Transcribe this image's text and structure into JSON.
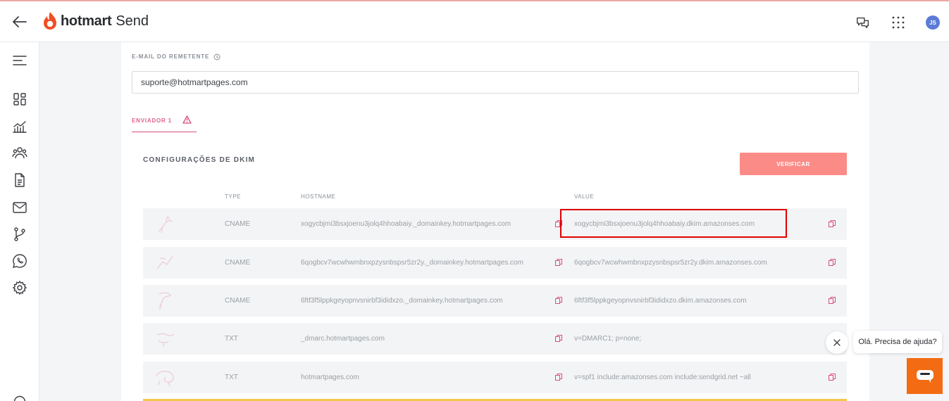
{
  "header": {
    "brand": "hotmart",
    "product": "Send",
    "avatar_initials": "JS"
  },
  "form": {
    "sender_email_label": "E-MAIL DO REMETENTE",
    "sender_email_value": "suporte@hotmartpages.com"
  },
  "tabs": [
    {
      "label": "ENVIADOR 1"
    }
  ],
  "dkim": {
    "title": "CONFIGURAÇÕES DE DKIM",
    "verify_label": "VERIFICAR",
    "columns": {
      "type": "TYPE",
      "hostname": "HOSTNAME",
      "value": "VALUE"
    },
    "rows": [
      {
        "type": "CNAME",
        "hostname": "xogycbjmi3bsxjoenu3jolq4hhoabaiy._domainkey.hotmartpages.com",
        "value": "xogycbjmi3bsxjoenu3jolq4hhoabaiy.dkim.amazonses.com"
      },
      {
        "type": "CNAME",
        "hostname": "6qogbcv7wcwhwmbnxpzysnbspsr5zr2y._domainkey.hotmartpages.com",
        "value": "6qogbcv7wcwhwmbnxpzysnbspsr5zr2y.dkim.amazonses.com"
      },
      {
        "type": "CNAME",
        "hostname": "6ftf3f5lppkgeyopnvsnirbf3ididxzo._domainkey.hotmartpages.com",
        "value": "6ftf3f5lppkgeyopnvsnirbf3ididxzo.dkim.amazonses.com"
      },
      {
        "type": "TXT",
        "hostname": "_dmarc.hotmartpages.com",
        "value": "v=DMARC1; p=none;"
      },
      {
        "type": "TXT",
        "hostname": "hotmartpages.com",
        "value": "v=spf1 include:amazonses.com include:sendgrid.net ~all"
      }
    ]
  },
  "chat": {
    "prompt": "Olá. Precisa de ajuda?"
  },
  "colors": {
    "accent": "#e0648c",
    "verify_button": "#fb8b87",
    "chat_button": "#f36b12",
    "highlight": "#e00000"
  },
  "icons": {
    "sidebar": [
      "menu-icon",
      "dashboard-icon",
      "analytics-icon",
      "contacts-icon",
      "document-icon",
      "mail-icon",
      "flow-icon",
      "whatsapp-icon",
      "settings-icon"
    ],
    "header": [
      "back-arrow-icon",
      "hotmart-flame-icon",
      "support-chat-icon",
      "apps-grid-icon"
    ]
  }
}
